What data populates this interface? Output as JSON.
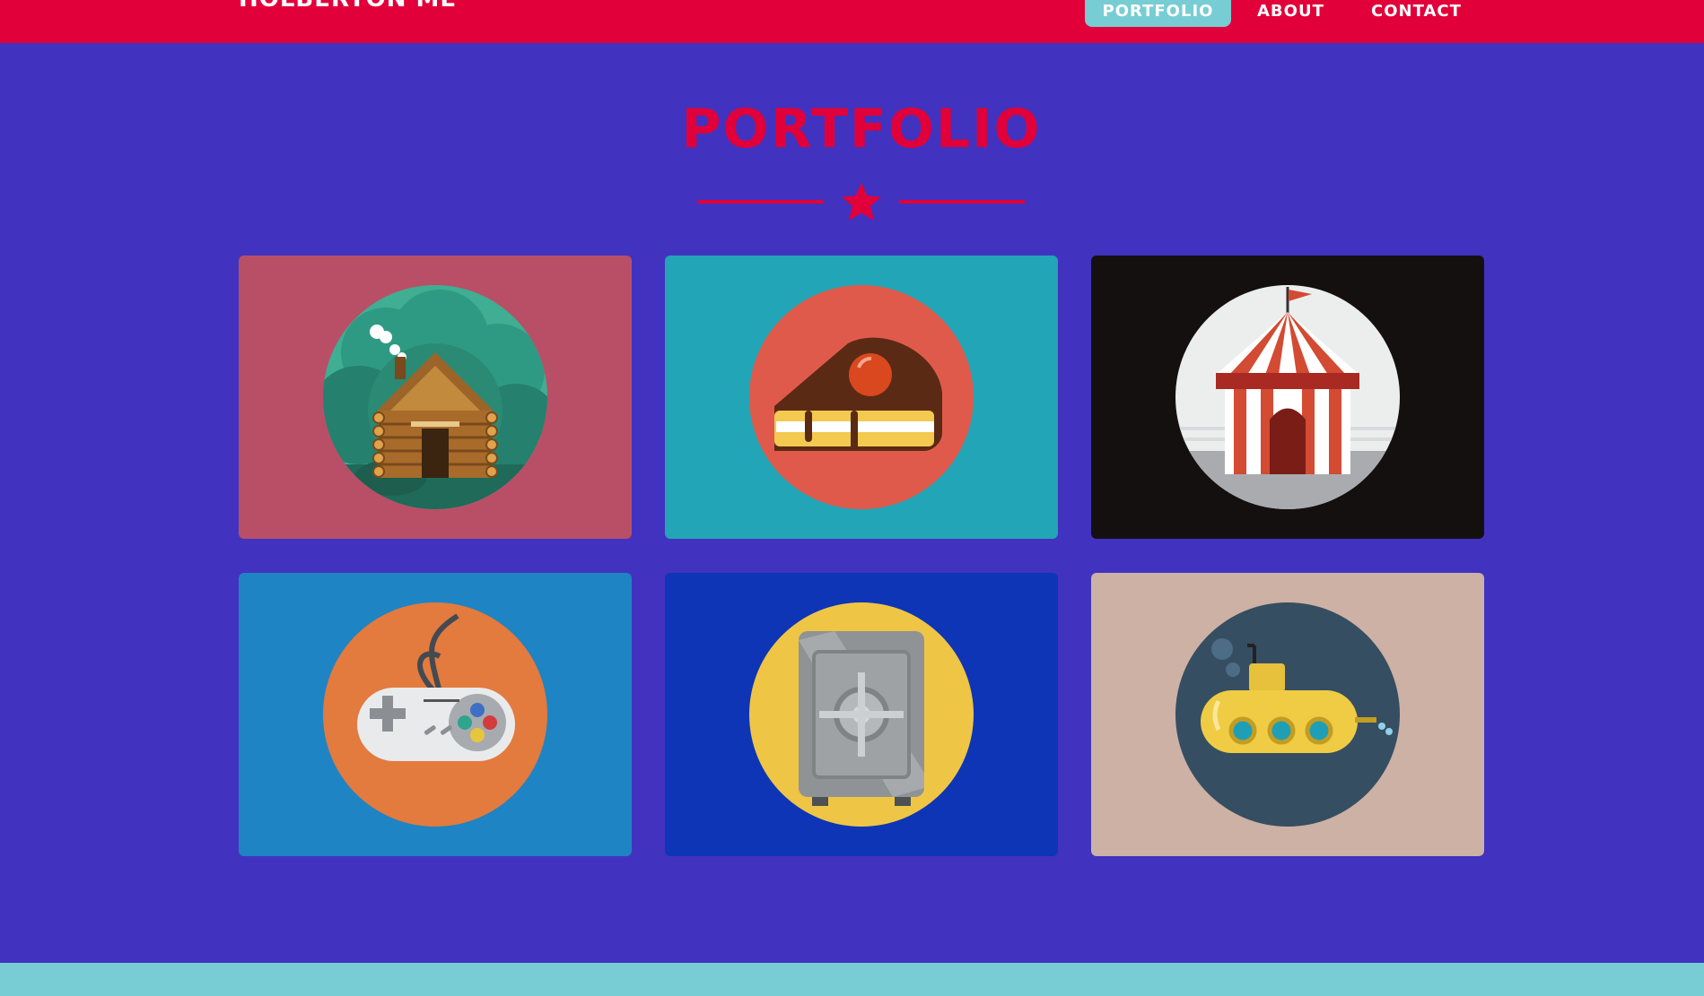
{
  "navbar": {
    "brand": "HOLBERTON ME",
    "items": [
      {
        "label": "PORTFOLIO",
        "active": true
      },
      {
        "label": "ABOUT",
        "active": false
      },
      {
        "label": "CONTACT",
        "active": false
      }
    ]
  },
  "portfolio": {
    "title": "PORTFOLIO",
    "items": [
      {
        "icon": "log-cabin-icon",
        "bg": "#b94f66",
        "circle": "#2f9a83"
      },
      {
        "icon": "cake-slice-icon",
        "bg": "#22a5b7",
        "circle": "#e05a4b"
      },
      {
        "icon": "circus-tent-icon",
        "bg": "#151010",
        "circle": "#eceeee"
      },
      {
        "icon": "game-controller-icon",
        "bg": "#1f84c3",
        "circle": "#e37a3e"
      },
      {
        "icon": "safe-icon",
        "bg": "#0e35b5",
        "circle": "#efc546"
      },
      {
        "icon": "submarine-icon",
        "bg": "#cdb1a5",
        "circle": "#354e62"
      }
    ]
  },
  "colors": {
    "accent": "#e10039",
    "background": "#4133bf",
    "footer": "#77cdd3"
  }
}
